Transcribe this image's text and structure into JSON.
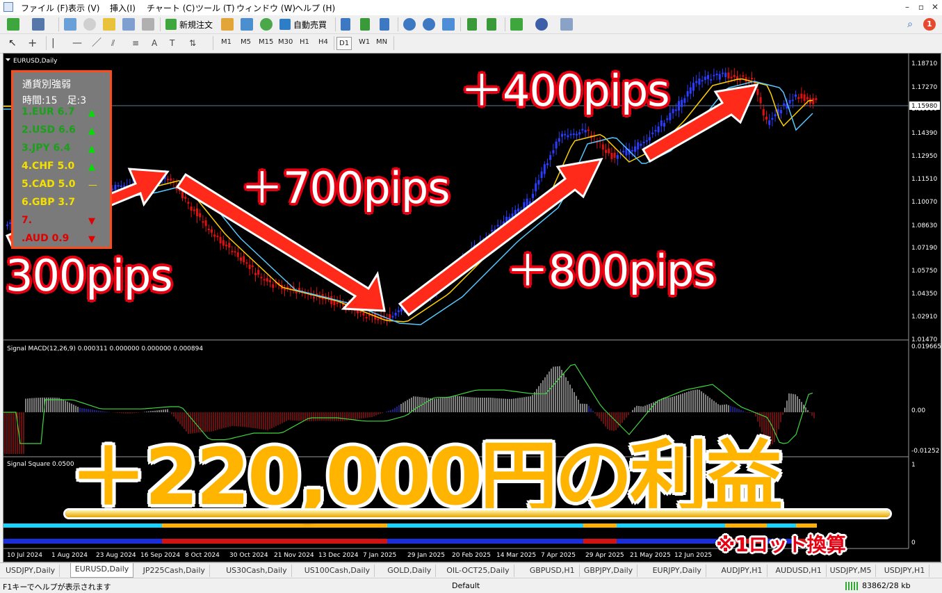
{
  "menu": [
    "ファイル (F)",
    "表示 (V)",
    "挿入(I)",
    "チャート (C)",
    "ツール (T)",
    "ウィンドウ (W)",
    "ヘルプ (H)"
  ],
  "window_buttons": [
    "–",
    "▫",
    "✕"
  ],
  "toolbar": {
    "new_order": "新規注文",
    "auto_trade": "自動売買",
    "timeframes": [
      "M1",
      "M5",
      "M15",
      "M30",
      "H1",
      "H4",
      "D1",
      "W1",
      "MN"
    ],
    "active_timeframe": "D1",
    "notification_count": "1"
  },
  "chart": {
    "symbol_label": "EURUSD,Daily",
    "price_axis": [
      "1.18710",
      "1.17270",
      "1.15980",
      "1.14390",
      "1.12950",
      "1.11510",
      "1.10070",
      "1.08630",
      "1.07190",
      "1.05750",
      "1.04350",
      "1.02910",
      "1.01470"
    ],
    "current_price": "1.15980",
    "macd_label": "Signal MACD(12,26,9) 0.000311 0.000000 0.000000 0.000894",
    "macd_axis": [
      "0.019665",
      "0.00",
      "-0.01252"
    ],
    "square_label": "Signal Square 0.0500",
    "square_axis": [
      "1",
      "0"
    ],
    "date_axis": [
      "10 Jul 2024",
      "1 Aug 2024",
      "23 Aug 2024",
      "16 Sep 2024",
      "8 Oct 2024",
      "30 Oct 2024",
      "21 Nov 2024",
      "13 Dec 2024",
      "7 Jan 2025",
      "29 Jan 2025",
      "20 Feb 2025",
      "14 Mar 2025",
      "7 Apr 2025",
      "29 Apr 2025",
      "21 May 2025",
      "12 Jun 2025"
    ]
  },
  "currency_panel": {
    "title": "通貨別強弱",
    "subtitle": "時間:15　足:3",
    "rows": [
      {
        "label": "1.EUR 6.7",
        "color": "#1aa01a",
        "arrow": "▲",
        "arrow_color": "#00e000"
      },
      {
        "label": "2.USD 6.6",
        "color": "#1aa01a",
        "arrow": "▲",
        "arrow_color": "#00e000"
      },
      {
        "label": "3.JPY  6.4",
        "color": "#1aa01a",
        "arrow": "▲",
        "arrow_color": "#00e000"
      },
      {
        "label": "4.CHF  5.0",
        "color": "#f4e000",
        "arrow": "▲",
        "arrow_color": "#00e000"
      },
      {
        "label": "5.CAD  5.0",
        "color": "#f4e000",
        "arrow": "—",
        "arrow_color": "#f4e000"
      },
      {
        "label": "6.GBP 3.7",
        "color": "#f4e000",
        "arrow": "",
        "arrow_color": "#f4e000"
      },
      {
        "label": "7.",
        "color": "#e00000",
        "arrow": "▼",
        "arrow_color": "#e00000"
      },
      {
        "label": ".AUD 0.9",
        "color": "#e00000",
        "arrow": "▼",
        "arrow_color": "#e00000"
      }
    ]
  },
  "overlays": {
    "pips_300": "300pips",
    "pips_700": "＋700pips",
    "pips_800": "＋800pips",
    "pips_400": "＋400pips",
    "profit": "＋220,000円の利益",
    "lot_note": "※1ロット換算"
  },
  "tabs": [
    "USDJPY,Daily",
    "EURUSD,Daily",
    "JP225Cash,Daily",
    "US30Cash,Daily",
    "US100Cash,Daily",
    "GOLD,Daily",
    "OIL-OCT25,Daily",
    "GBPUSD,H1",
    "GBPJPY,Daily",
    "EURJPY,Daily",
    "AUDJPY,H1",
    "AUDUSD,H1",
    "USDJPY,M5",
    "USDJPY,H1"
  ],
  "active_tab": "EURUSD,Daily",
  "status": {
    "help": "F1キーでヘルプが表示されます",
    "profile": "Default",
    "traffic": "83862/28 kb"
  }
}
